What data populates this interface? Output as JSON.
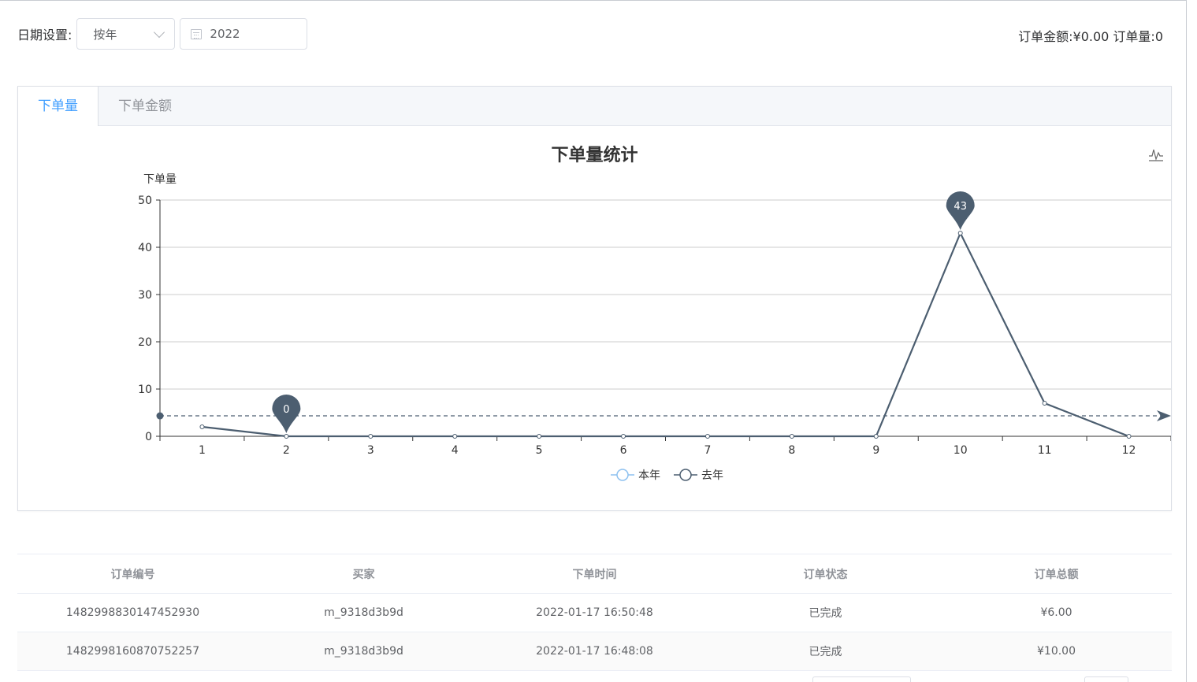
{
  "toolbar": {
    "date_label": "日期设置:",
    "period_select": "按年",
    "year_value": "2022"
  },
  "summary": {
    "text": "订单金额:¥0.00 订单量:0"
  },
  "tabs": [
    {
      "label": "下单量",
      "active": true
    },
    {
      "label": "下单金额",
      "active": false
    }
  ],
  "chart": {
    "title": "下单量统计",
    "ylabel": "下单量",
    "legend": [
      "本年",
      "去年"
    ],
    "markers": {
      "min_label": "0",
      "max_label": "43"
    }
  },
  "chart_data": {
    "type": "line",
    "title": "下单量统计",
    "xlabel": "",
    "ylabel": "下单量",
    "categories": [
      "1",
      "2",
      "3",
      "4",
      "5",
      "6",
      "7",
      "8",
      "9",
      "10",
      "11",
      "12"
    ],
    "series": [
      {
        "name": "本年",
        "values": [
          2,
          0,
          0,
          0,
          0,
          0,
          0,
          0,
          0,
          43,
          7,
          0
        ]
      },
      {
        "name": "去年",
        "values": []
      }
    ],
    "ylim": [
      0,
      50
    ],
    "yticks": [
      0,
      10,
      20,
      30,
      40,
      50
    ],
    "mark_points": [
      {
        "category": "2",
        "value": 0,
        "label": "0"
      },
      {
        "category": "10",
        "value": 43,
        "label": "43"
      }
    ],
    "mark_line": {
      "type": "average",
      "value": 4.33
    },
    "legend_position": "bottom",
    "grid": true,
    "colors": {
      "line": "#4c5e70",
      "axis": "#333333",
      "grid": "#cccccc",
      "legend_this_year": "#8ec1f0",
      "legend_last_year": "#4c5e70"
    }
  },
  "table": {
    "headers": [
      "订单编号",
      "买家",
      "下单时间",
      "订单状态",
      "订单总额"
    ],
    "rows": [
      [
        "1482998830147452930",
        "m_9318d3b9d",
        "2022-01-17 16:50:48",
        "已完成",
        "¥6.00"
      ],
      [
        "1482998160870752257",
        "m_9318d3b9d",
        "2022-01-17 16:48:08",
        "已完成",
        "¥10.00"
      ]
    ]
  },
  "icons": {
    "select_arrow": "chevron-down-icon",
    "date": "calendar-icon",
    "chart_toolbox": "line-chart-icon"
  }
}
